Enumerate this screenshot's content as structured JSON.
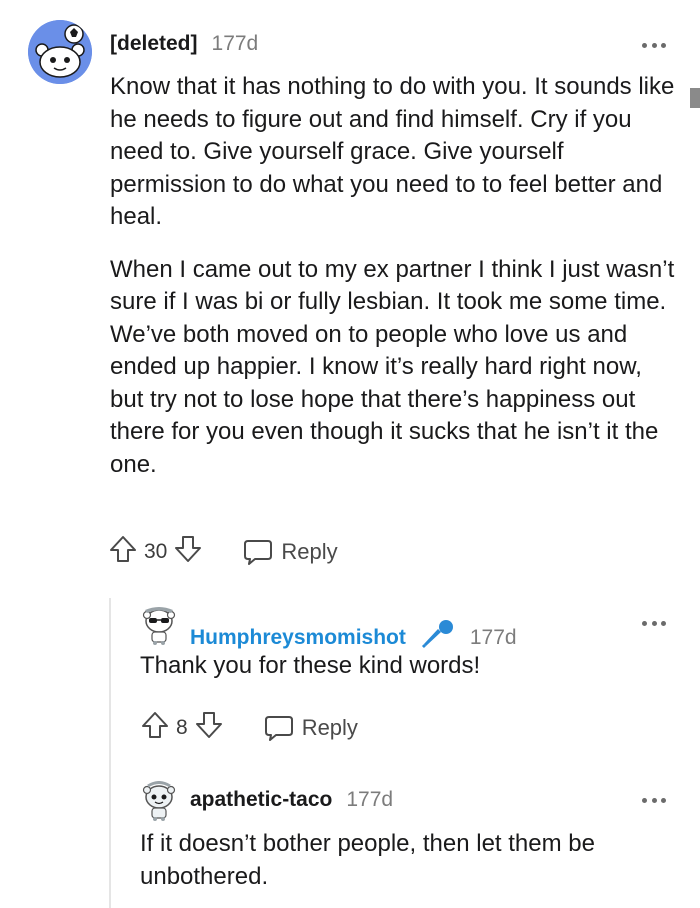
{
  "comments": [
    {
      "author": "[deleted]",
      "age": "177d",
      "paragraphs": [
        "Know that it has nothing to do with you. It sounds like he needs to figure out and find himself. Cry if you need to. Give yourself grace. Give yourself permission to do what you need to to feel better and heal.",
        "When I came out to my ex partner I think I just wasn’t sure if I was bi or fully lesbian. It took me some time. We’ve both moved on to people who love us and ended up happier. I know it’s really hard right now, but try not to lose hope that there’s happiness out there for you even though it sucks that he isn’t it the one."
      ],
      "votes": "30",
      "reply_label": "Reply",
      "avatar_icon": "reddit-snoo-avatar-icon"
    },
    {
      "author": "Humphreysmomishot",
      "age": "177d",
      "flair_icon": "microphone-icon",
      "text": "Thank you for these kind words!",
      "votes": "8",
      "reply_label": "Reply",
      "avatar_icon": "snoo-sunglasses-avatar-icon"
    },
    {
      "author": "apathetic-taco",
      "age": "177d",
      "text": "If it doesn’t bother people, then let them be unbothered.",
      "avatar_icon": "snoo-avatar-icon"
    }
  ],
  "colors": {
    "author_link": "#1c8ad6",
    "avatar_bg": "#6a8fe8",
    "mic": "#2a8ad6"
  }
}
